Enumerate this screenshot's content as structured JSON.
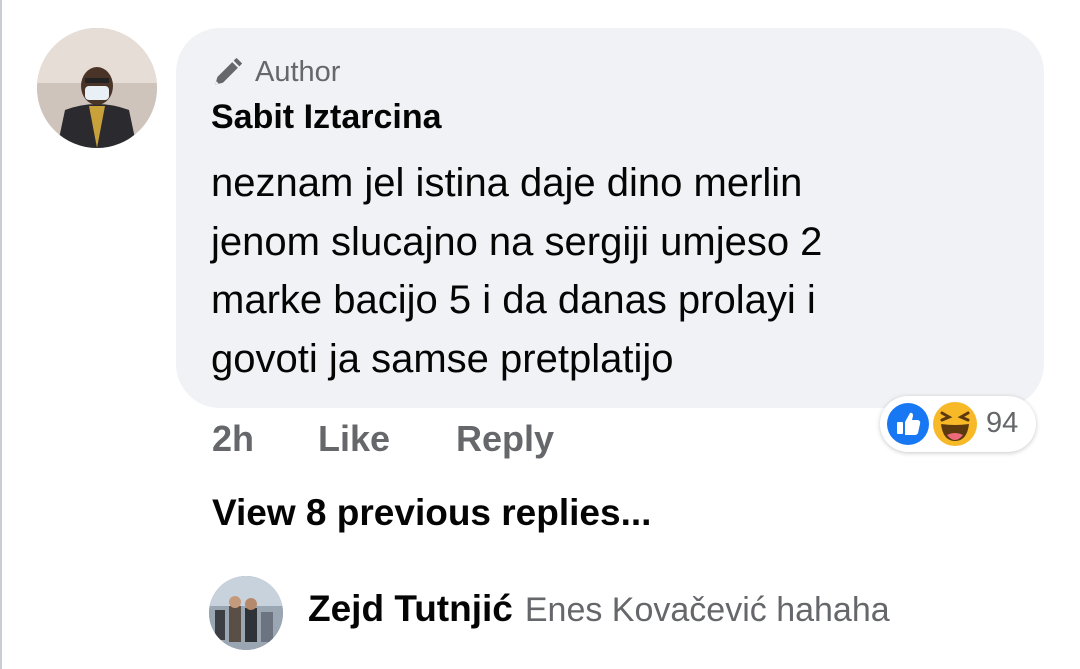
{
  "comment": {
    "author_badge": "Author",
    "author_badge_icon": "pencil-icon",
    "name": "Sabit Iztarcina",
    "text_lines": [
      "neznam jel istina daje dino merlin",
      "jenom slucajno na sergiji umjeso 2",
      "marke bacijo 5 i da danas prolayi i",
      "govoti ja samse pretplatijo"
    ],
    "time": "2h",
    "like_label": "Like",
    "reply_label": "Reply",
    "reactions": {
      "types": [
        "like",
        "haha"
      ],
      "count": "94"
    }
  },
  "view_previous_label": "View 8 previous replies...",
  "latest_reply": {
    "name": "Zejd Tutnjić",
    "text": "Enes Kovačević hahaha"
  },
  "colors": {
    "bubble_bg": "#f0f2f5",
    "secondary_text": "#65676b",
    "like_blue": "#1877f2",
    "haha_yellow": "#f7b928"
  }
}
